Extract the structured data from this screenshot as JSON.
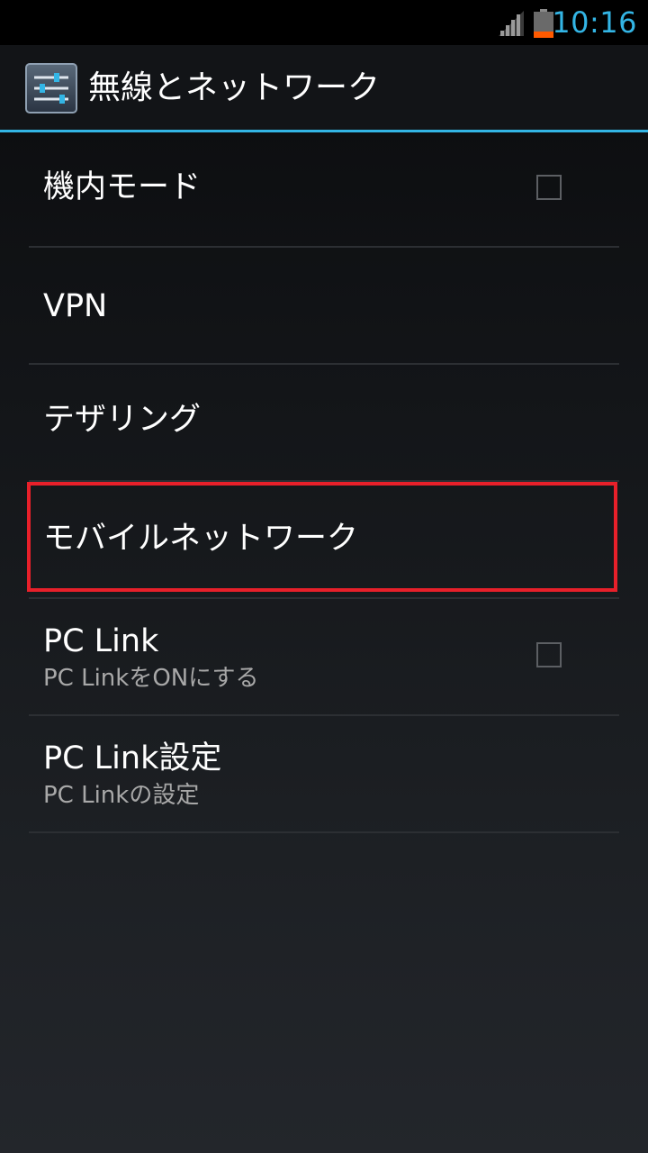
{
  "status_bar": {
    "time": "10:16",
    "signal_icon": "signal-icon",
    "battery_icon": "battery-low-icon",
    "accent_color": "#33b5e5",
    "battery_color": "#ff5a00"
  },
  "action_bar": {
    "title": "無線とネットワーク",
    "icon": "settings-sliders-icon",
    "underline_color": "#33b5e5"
  },
  "settings": [
    {
      "title": "機内モード",
      "summary": "",
      "has_checkbox": true,
      "checked": false
    },
    {
      "title": "VPN",
      "summary": "",
      "has_checkbox": false
    },
    {
      "title": "テザリング",
      "summary": "",
      "has_checkbox": false
    },
    {
      "title": "モバイルネットワーク",
      "summary": "",
      "has_checkbox": false,
      "highlighted": true
    },
    {
      "title": "PC Link",
      "summary": "PC LinkをONにする",
      "has_checkbox": true,
      "checked": false
    },
    {
      "title": "PC Link設定",
      "summary": "PC Linkの設定",
      "has_checkbox": false
    }
  ],
  "highlight_color": "#e8202a"
}
